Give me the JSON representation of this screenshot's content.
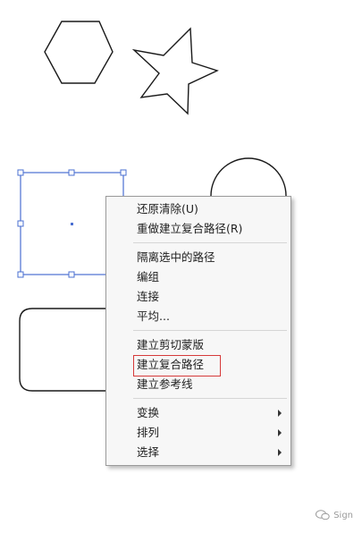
{
  "menu": {
    "items": [
      {
        "label": "还原清除(U)"
      },
      {
        "label": "重做建立复合路径(R)"
      },
      {
        "label": "隔离选中的路径"
      },
      {
        "label": "编组"
      },
      {
        "label": "连接"
      },
      {
        "label": "平均..."
      },
      {
        "label": "建立剪切蒙版"
      },
      {
        "label": "建立复合路径",
        "highlighted": true
      },
      {
        "label": "建立参考线"
      },
      {
        "label": "变换",
        "submenu": true
      },
      {
        "label": "排列",
        "submenu": true
      },
      {
        "label": "选择",
        "submenu": true
      }
    ],
    "highlight_color": "#d63a3a"
  },
  "shapes": {
    "stroke_color": "#1a1a1a",
    "selection_color": "#4a6fd1",
    "items": [
      "hexagon",
      "star",
      "semicircle",
      "rounded-rectangle",
      "selected-square"
    ]
  },
  "watermark": {
    "text": "Sign",
    "icon": "wechat-icon"
  }
}
